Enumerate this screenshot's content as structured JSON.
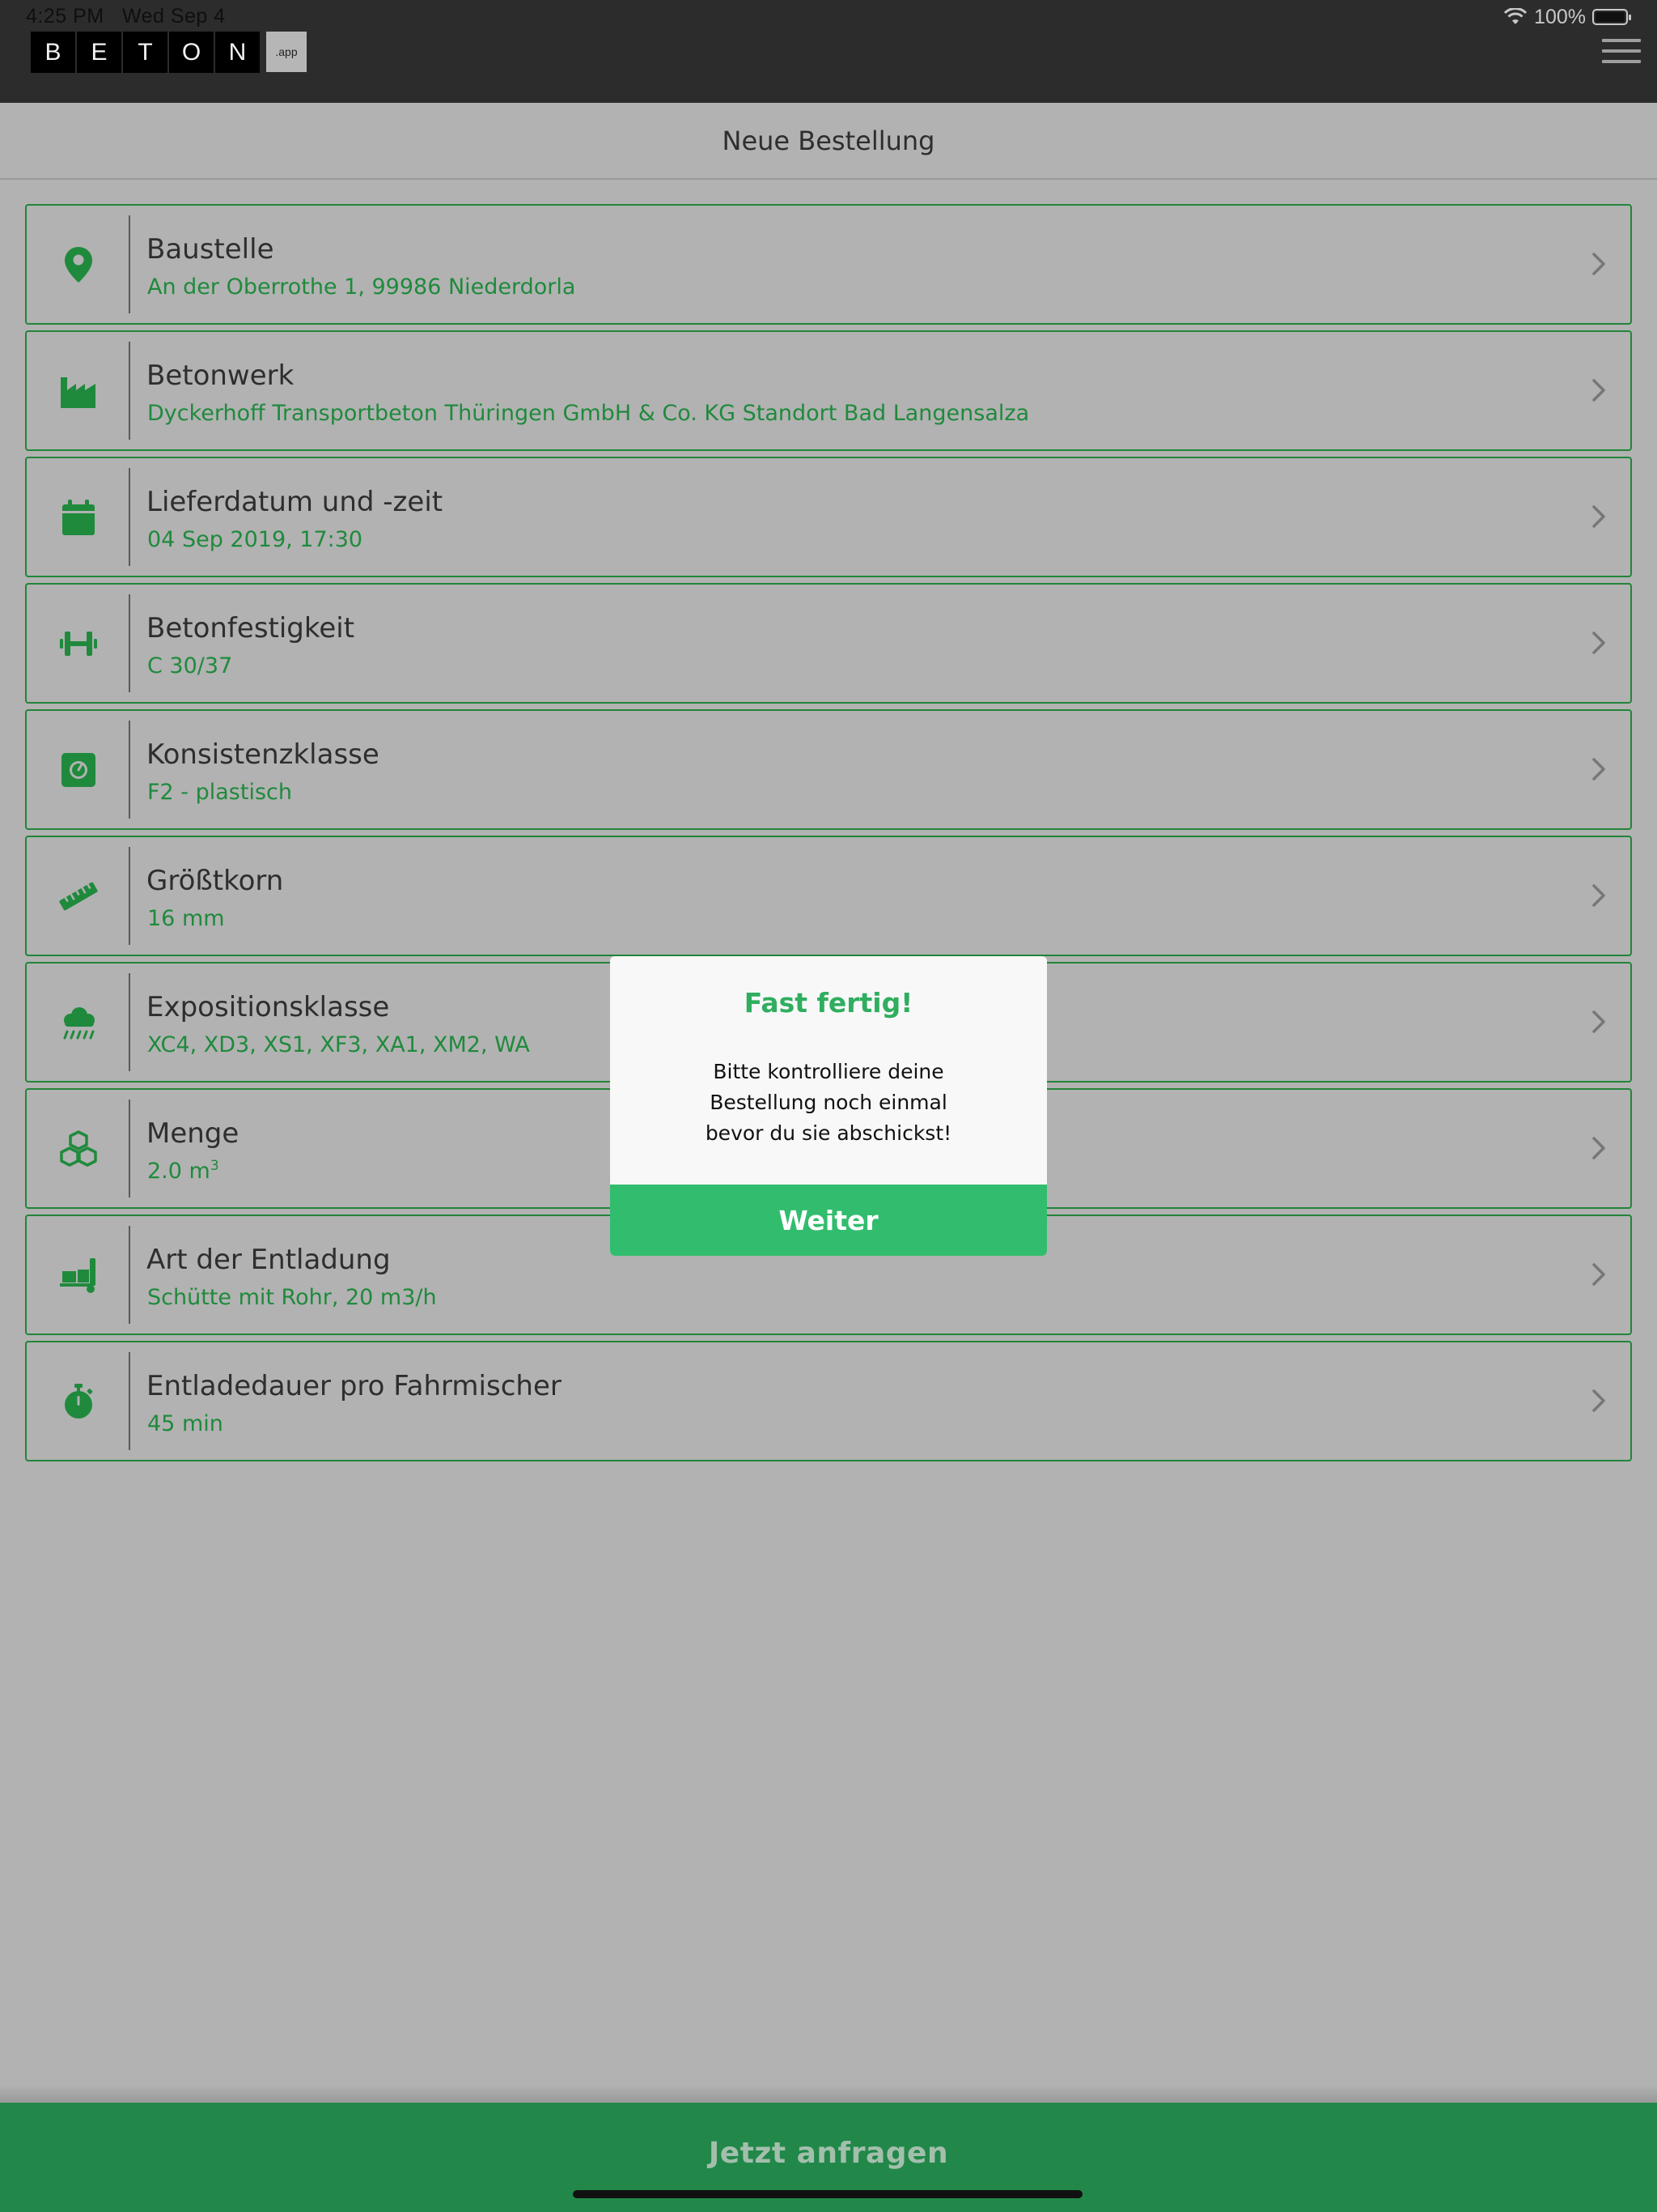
{
  "status_bar": {
    "time": "4:25 PM",
    "date": "Wed Sep 4",
    "battery": "100%"
  },
  "header": {
    "logo_letters": [
      "B",
      "E",
      "T",
      "O",
      "N"
    ],
    "logo_suffix": ".app"
  },
  "page": {
    "title": "Neue Bestellung"
  },
  "rows": [
    {
      "icon": "location-pin-icon",
      "title": "Baustelle",
      "value": "An der Oberrothe 1, 99986 Niederdorla"
    },
    {
      "icon": "factory-icon",
      "title": "Betonwerk",
      "value": "Dyckerhoff Transportbeton Thüringen GmbH & Co. KG Standort Bad Langensalza"
    },
    {
      "icon": "calendar-icon",
      "title": "Lieferdatum und -zeit",
      "value": "04 Sep 2019, 17:30"
    },
    {
      "icon": "dumbbell-icon",
      "title": "Betonfestigkeit",
      "value": "C 30/37"
    },
    {
      "icon": "scale-gauge-icon",
      "title": "Konsistenzklasse",
      "value": "F2 - plastisch"
    },
    {
      "icon": "ruler-icon",
      "title": "Größtkorn",
      "value": "16 mm"
    },
    {
      "icon": "cloud-rain-icon",
      "title": "Expositionsklasse",
      "value": "XC4, XD3, XS1, XF3, XA1, XM2, WA"
    },
    {
      "icon": "cubes-icon",
      "title": "Menge",
      "value": "2.0 m",
      "value_sup": "3"
    },
    {
      "icon": "dolly-icon",
      "title": "Art der Entladung",
      "value": "Schütte mit Rohr, 20 m3/h"
    },
    {
      "icon": "stopwatch-icon",
      "title": "Entladedauer pro Fahrmischer",
      "value": "45 min"
    }
  ],
  "dialog": {
    "title": "Fast fertig!",
    "message": "Bitte kontrolliere deine\nBestellung noch einmal\nbevor du sie abschickst!",
    "button_label": "Weiter"
  },
  "footer": {
    "submit_label": "Jetzt anfragen"
  },
  "colors": {
    "accent": "#1f8a3c",
    "dialog_button": "#32bd6e",
    "footer": "#21884a"
  }
}
